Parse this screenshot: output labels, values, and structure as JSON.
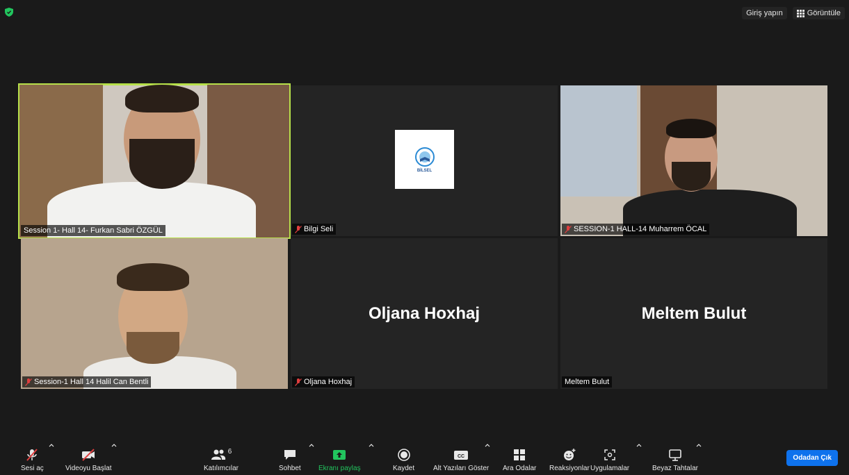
{
  "top_bar": {
    "signin_label": "Giriş yapın",
    "view_label": "Görüntüle"
  },
  "participants": [
    {
      "name": "Session 1- Hall 14- Furkan Sabri ÖZGÜL",
      "muted": false,
      "active": true,
      "kind": "video"
    },
    {
      "name": "Bilgi Seli",
      "muted": true,
      "kind": "logo",
      "logo_text": "BİLSEL"
    },
    {
      "name": "SESSION-1 HALL-14 Muharrem ÖCAL",
      "muted": true,
      "kind": "video"
    },
    {
      "name": "Session-1 Hall 14 Halil Can Bentli",
      "muted": true,
      "kind": "video"
    },
    {
      "name": "Oljana Hoxhaj",
      "display_name": "Oljana Hoxhaj",
      "muted": true,
      "kind": "name"
    },
    {
      "name": "Meltem Bulut",
      "display_name": "Meltem Bulut",
      "muted": false,
      "kind": "name"
    }
  ],
  "toolbar": {
    "audio_label": "Sesi aç",
    "video_label": "Videoyu Başlat",
    "participants_label": "Katılımcılar",
    "participants_count": "6",
    "chat_label": "Sohbet",
    "share_label": "Ekranı paylaş",
    "record_label": "Kaydet",
    "captions_label": "Alt Yazıları Göster",
    "breakout_label": "Ara Odalar",
    "reactions_label": "Reaksiyonlar",
    "apps_label": "Uygulamalar",
    "whiteboard_label": "Beyaz Tahtalar",
    "leave_label": "Odadan Çık"
  },
  "colors": {
    "active_border": "#b7e04a",
    "share_green": "#22c55e",
    "leave_blue": "#0e72ed",
    "mute_red": "#e03e3e"
  }
}
